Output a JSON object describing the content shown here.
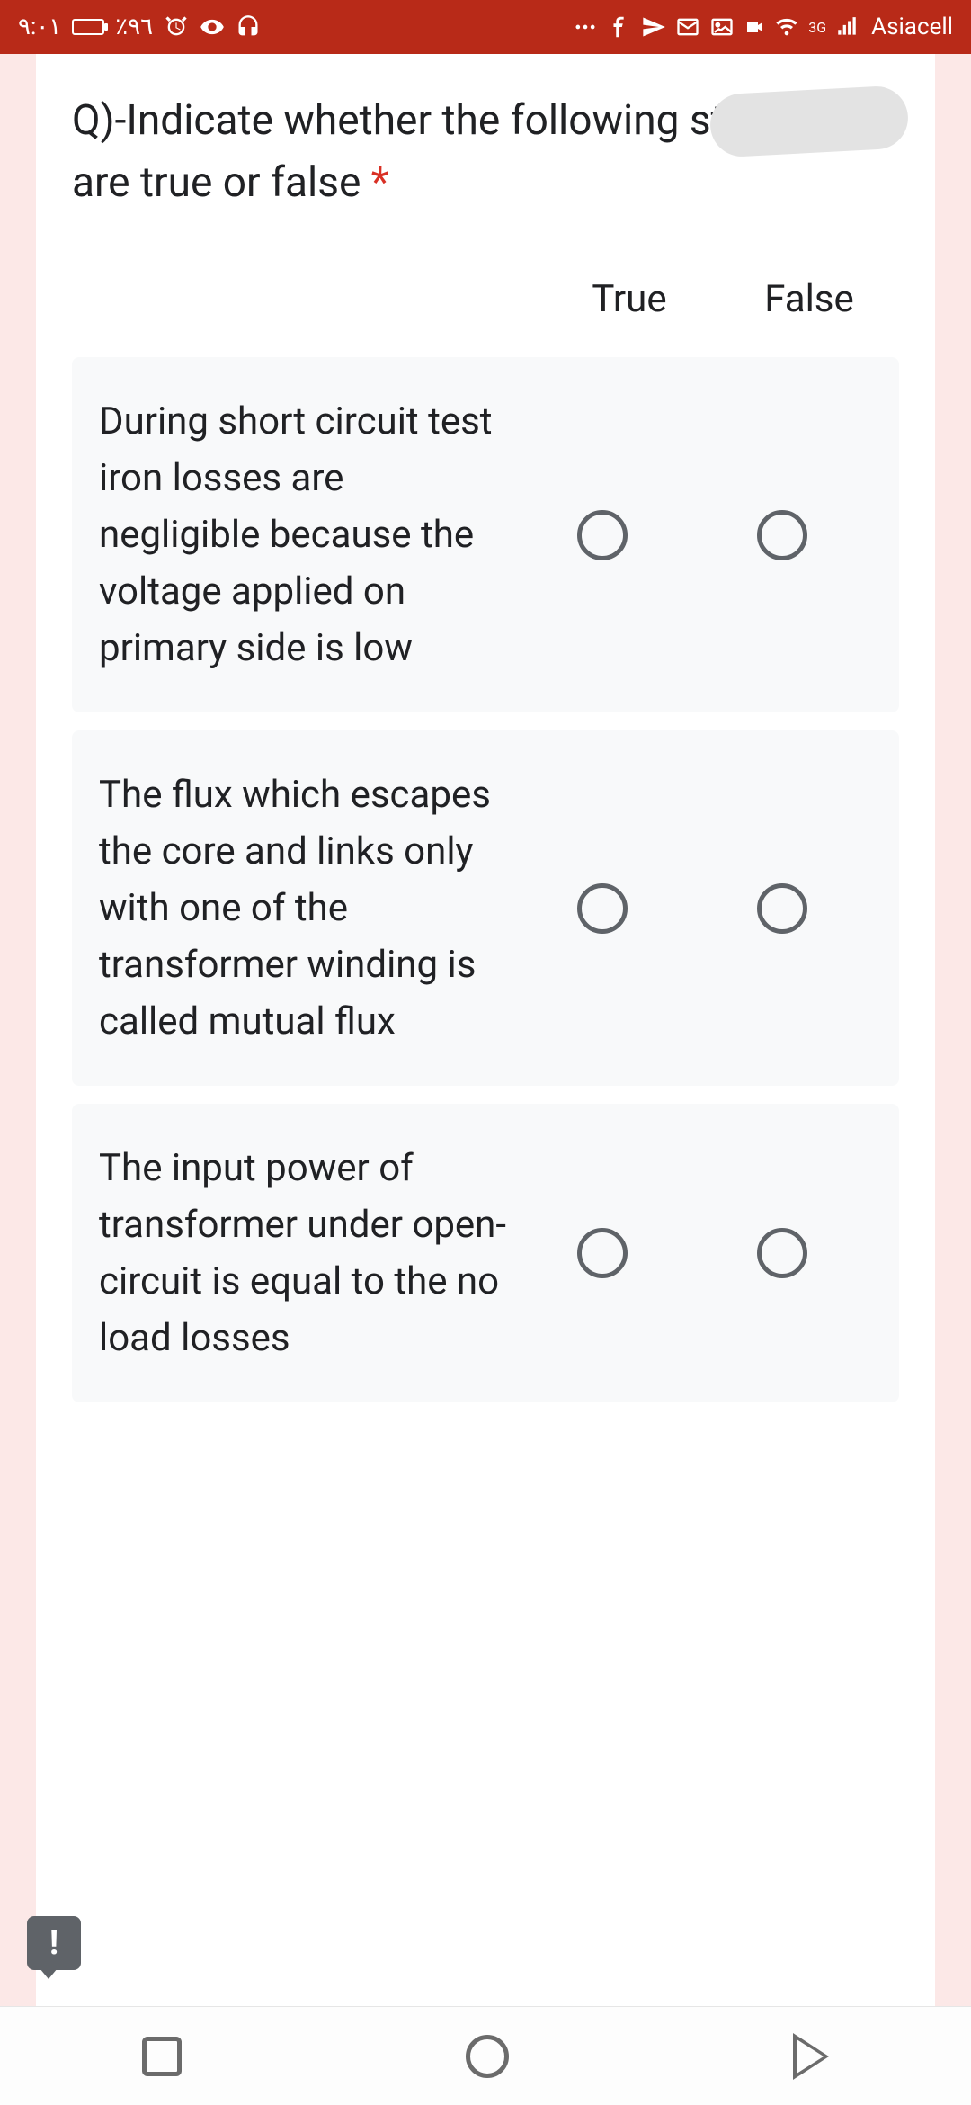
{
  "status": {
    "time": "٩:٠١",
    "battery_pct": "٪٩٦",
    "network_label": "3G",
    "carrier": "Asiacell"
  },
  "form": {
    "question_title": "Q)-Indicate whether the following statements are true or false",
    "required_marker": "*",
    "columns": [
      "True",
      "False"
    ],
    "rows": [
      {
        "text": "During short circuit test iron losses are negligible because the voltage applied on primary side is low"
      },
      {
        "text": "The flux which escapes the core and links only with one of the transformer winding is called mutual flux"
      },
      {
        "text": "The input power of transformer under open-circuit is equal to the no load losses"
      }
    ]
  },
  "report_badge": "!"
}
